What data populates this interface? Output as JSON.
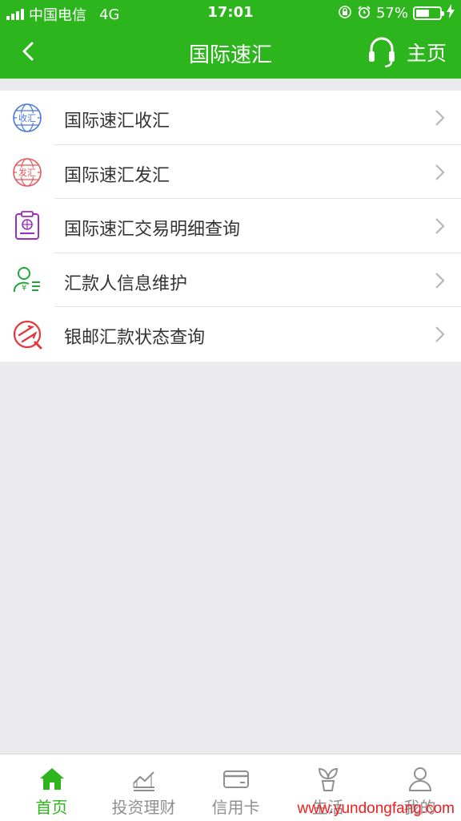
{
  "status_bar": {
    "carrier": "中国电信",
    "network": "4G",
    "time": "17:01",
    "battery": "57%",
    "battery_level": 0.57
  },
  "navbar": {
    "title": "国际速汇",
    "home_label": "主页",
    "back_icon": "chevron-left-icon",
    "home_icon": "headset-icon"
  },
  "menu": {
    "items": [
      {
        "label": "国际速汇收汇",
        "icon": "receive-remittance-icon"
      },
      {
        "label": "国际速汇发汇",
        "icon": "send-remittance-icon"
      },
      {
        "label": "国际速汇交易明细查询",
        "icon": "transaction-detail-icon"
      },
      {
        "label": "汇款人信息维护",
        "icon": "remitter-info-icon"
      },
      {
        "label": "银邮汇款状态查询",
        "icon": "remittance-status-icon"
      }
    ]
  },
  "tabbar": {
    "tabs": [
      {
        "label": "首页",
        "icon": "home-icon",
        "active": true
      },
      {
        "label": "投资理财",
        "icon": "investment-chart-icon"
      },
      {
        "label": "信用卡",
        "icon": "credit-card-icon"
      },
      {
        "label": "生活",
        "icon": "sprout-icon"
      },
      {
        "label": "我的",
        "icon": "user-icon"
      }
    ]
  },
  "watermark": "www.yundongfang.com",
  "colors": {
    "brand_green": "#2db51d",
    "background": "#ebebed",
    "inactive_tab": "#8f8f8f",
    "watermark_red": "#f01e1e"
  }
}
